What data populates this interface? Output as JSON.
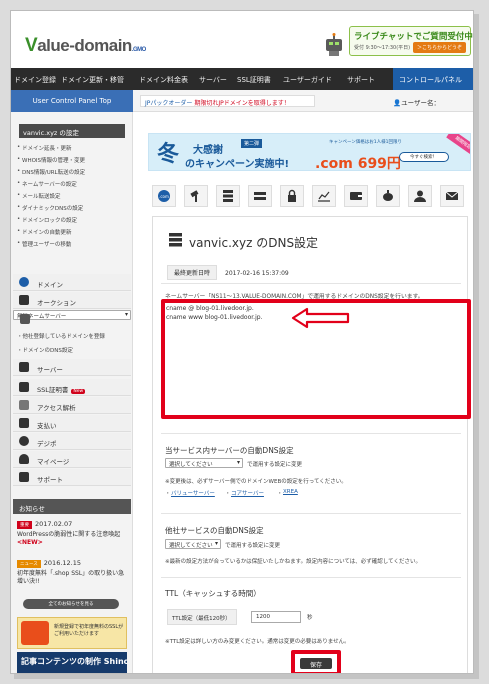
{
  "header": {
    "logo_main": "alue-domain",
    "logo_v": "V",
    "logo_suffix": ".GMO",
    "chat_title": "ライブチャットでご質問受付中",
    "chat_hours": "受付 9:30〜17:30(平日)",
    "chat_button": "＞こちらからどうぞ"
  },
  "nav": {
    "items": [
      "ドメイン登録",
      "ドメイン更新・移管",
      "ドメイン料金表",
      "サーバー",
      "SSL証明書",
      "ユーザーガイド",
      "サポート"
    ],
    "control_panel": "コントロールパネル"
  },
  "subbar": {
    "panel_top": "User Control Panel Top",
    "notice_link": "JPパックオーダー",
    "notice_text": "期限切れJPドメインを取得します！",
    "user_label": "ユーザー名："
  },
  "sidebar": {
    "domain_setting": "vanvic.xyz の設定",
    "menu": [
      "ドメイン延長・更新",
      "WHOIS情報の管理・変更",
      "DNS情報/URL転送の設定",
      "ネームサーバーの設定",
      "メール転送設定",
      "ダイナミックDNSの設定",
      "ドメインロックの設定",
      "ドメインの自動更新",
      "管理ユーザーの移動"
    ],
    "categories": [
      "ドメイン",
      "オークション",
      "無料ネームサーバー",
      "サーバー",
      "SSL証明書",
      "アクセス解析",
      "支払い",
      "デジポ",
      "マイページ",
      "サポート"
    ],
    "ns_sub": [
      "他社登録しているドメインを登録",
      "ドメインのDNS設定"
    ],
    "ssl_badge": "New",
    "news_head": "お知らせ",
    "news": [
      {
        "tag": "重要",
        "date": "2017.02.07",
        "text": "WordPressの脆弱性に関する注意喚起",
        "new": "<NEW>"
      },
      {
        "tag": "ニュース",
        "date": "2016.12.15",
        "text": "初年度無料「.shop SSL」の取り扱い急增い決!!"
      }
    ],
    "all_news": "全てのお知らせを見る",
    "banner1": "新規登録で初年度無料のSSLがご利用いただけます",
    "banner2": "記事コンテンツの制作 Shinobi"
  },
  "banner": {
    "fuyu": "冬",
    "kansha": "大感謝",
    "dai": "第二弾",
    "campaign": "のキャンペーン実施中!",
    "price": ".com 699円",
    "note": "キャンペーン価格はお1人様1回限り",
    "search": "今すぐ検索！",
    "ribbon": "期間限定"
  },
  "panel": {
    "title": "vanvic.xyz のDNS設定",
    "updated_label": "最終更新日時",
    "updated_value": "2017-02-16 15:37:09",
    "ns_desc": "ネームサーバー「NS11～13.VALUE-DOMAIN.COM」で運用するドメインのDNS設定を行います。",
    "records": [
      "cname @ blog-01.livedoor.jp.",
      "cname www blog-01.livedoor.jp."
    ],
    "auto_dns_title": "当サービス内サーバーの自動DNS設定",
    "select_placeholder": "選択してください",
    "apply_text": "で運用する設定に変更",
    "auto_note": "※変更後は、必ずサーバー側でのドメインWEBの設定を行ってください。",
    "links": [
      "バリューサーバー",
      "コアサーバー",
      "XREA"
    ],
    "other_dns_title": "他社サービスの自動DNS設定",
    "other_note": "※最新の設定方法が合っているかは保証いたしかねます。設定内容については、必ず確認してください。",
    "ttl_title": "TTL（キャッシュする時間）",
    "ttl_label": "TTL設定（最低120秒）",
    "ttl_value": "1200",
    "ttl_unit": "秒",
    "ttl_note": "※TTL設定は詳しい方のみ変更ください。通常は変更の必要はありません。",
    "save": "保存"
  },
  "colors": {
    "highlight_red": "#e2001a",
    "nav_dark": "#2b2b2b",
    "accent_blue": "#3a6fb6",
    "link_blue": "#1d5ea8"
  }
}
